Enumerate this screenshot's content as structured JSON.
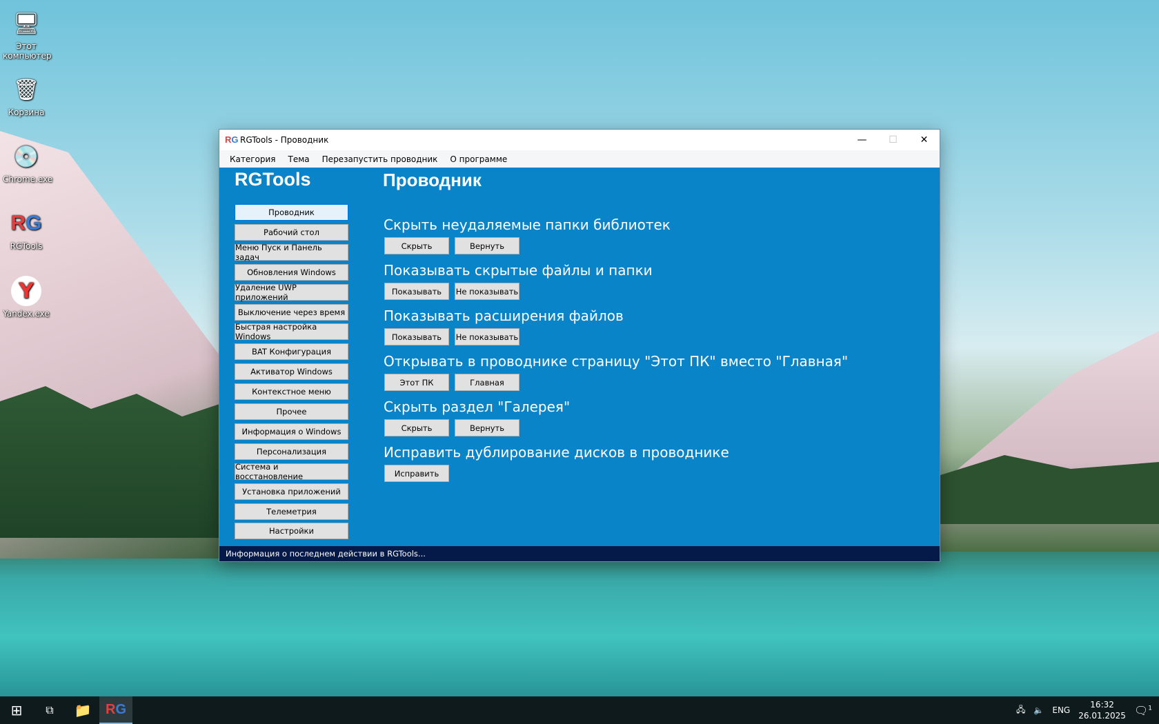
{
  "desktop": {
    "icons": [
      {
        "label": "Этот компьютер",
        "icon": "computer-icon"
      },
      {
        "label": "Корзина",
        "icon": "recycle-bin-icon"
      },
      {
        "label": "Chrome.exe",
        "icon": "installer-icon"
      },
      {
        "label": "RGTools",
        "icon": "rgtools-icon"
      },
      {
        "label": "Yandex.exe",
        "icon": "yandex-icon"
      }
    ]
  },
  "window": {
    "title": "RGTools - Проводник",
    "menu": [
      "Категория",
      "Тема",
      "Перезапустить проводник",
      "О программе"
    ],
    "sidebar": {
      "title": "RGTools",
      "items": [
        "Проводник",
        "Рабочий стол",
        "Меню Пуск и Панель задач",
        "Обновления Windows",
        "Удаление UWP приложений",
        "Выключение через время",
        "Быстрая настройка Windows",
        "BAT Конфигурация",
        "Активатор Windows",
        "Контекстное меню",
        "Прочее",
        "Информация о Windows",
        "Персонализация",
        "Система и восстановление",
        "Установка приложений",
        "Телеметрия",
        "Настройки"
      ],
      "active": "Проводник"
    },
    "main": {
      "title": "Проводник",
      "sections": [
        {
          "label": "Скрыть неудаляемые папки библиотек",
          "buttons": [
            "Скрыть",
            "Вернуть"
          ]
        },
        {
          "label": "Показывать скрытые файлы и папки",
          "buttons": [
            "Показывать",
            "Не показывать"
          ]
        },
        {
          "label": "Показывать расширения файлов",
          "buttons": [
            "Показывать",
            "Не показывать"
          ]
        },
        {
          "label": "Открывать в проводнике страницу \"Этот ПК\" вместо \"Главная\"",
          "buttons": [
            "Этот ПК",
            "Главная"
          ]
        },
        {
          "label": "Скрыть раздел \"Галерея\"",
          "buttons": [
            "Скрыть",
            "Вернуть"
          ]
        },
        {
          "label": "Исправить дублирование дисков в проводнике",
          "buttons": [
            "Исправить"
          ]
        }
      ]
    },
    "status": "Информация о последнем действии в RGTools...",
    "colors": {
      "content": "#0a84c8",
      "status": "#061a4a"
    }
  },
  "taskbar": {
    "lang": "ENG",
    "time": "16:32",
    "date": "26.01.2025",
    "notifications": "1"
  }
}
